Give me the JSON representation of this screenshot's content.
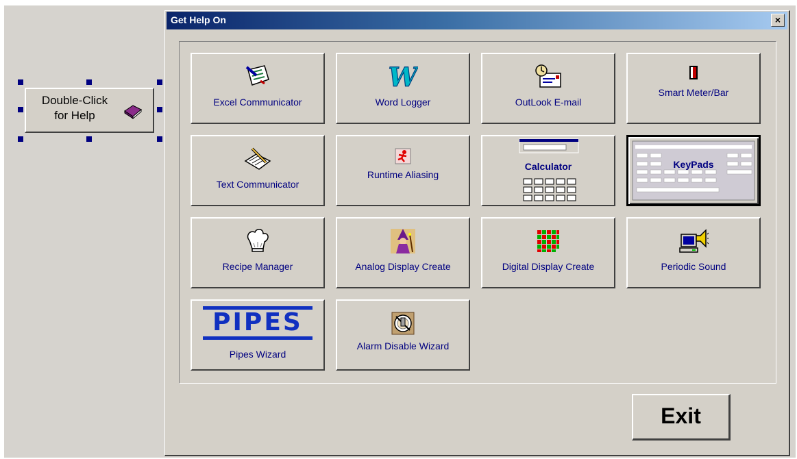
{
  "design_object": {
    "line1": "Double-Click",
    "line2": "for Help",
    "icon": "book-icon"
  },
  "dialog": {
    "title": "Get Help On",
    "close_label": "×",
    "exit_label": "Exit"
  },
  "tiles": [
    {
      "label": "Excel Communicator",
      "icon": "excel-communicator-icon"
    },
    {
      "label": "Word Logger",
      "icon": "word-logger-icon"
    },
    {
      "label": "OutLook E-mail",
      "icon": "outlook-email-icon"
    },
    {
      "label": "Smart Meter/Bar",
      "icon": "smart-meter-icon"
    },
    {
      "label": "Text Communicator",
      "icon": "text-communicator-icon"
    },
    {
      "label": "Runtime Aliasing",
      "icon": "runtime-aliasing-icon"
    },
    {
      "label": "Calculator",
      "icon": "calculator-icon"
    },
    {
      "label": "KeyPads",
      "icon": "keypads-icon"
    },
    {
      "label": "Recipe Manager",
      "icon": "chef-hat-icon"
    },
    {
      "label": "Analog Display Create",
      "icon": "wizard-icon"
    },
    {
      "label": "Digital Display Create",
      "icon": "digital-grid-icon"
    },
    {
      "label": "Periodic Sound",
      "icon": "speaker-computer-icon"
    },
    {
      "label": "Pipes Wizard",
      "icon": "pipes-icon",
      "logo_text": "PIPES"
    },
    {
      "label": "Alarm Disable Wizard",
      "icon": "alarm-disable-icon"
    }
  ]
}
